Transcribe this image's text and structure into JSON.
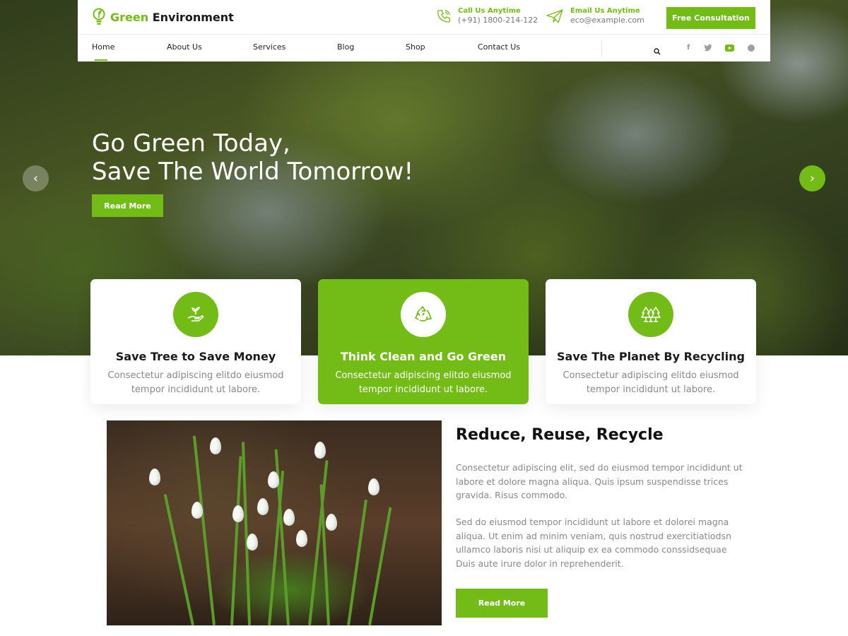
{
  "brand": {
    "name_part1": "Green",
    "name_part2": " Environment"
  },
  "header": {
    "call_label": "Call Us Anytime",
    "call_value": "(+91) 1800-214-122",
    "email_label": "Email Us Anytime",
    "email_value": "eco@example.com",
    "cta_label": "Free Consultation"
  },
  "nav": {
    "items": [
      "Home",
      "About Us",
      "Services",
      "Blog",
      "Shop",
      "Contact Us"
    ],
    "active": "Home"
  },
  "social_icons": [
    "facebook-icon",
    "twitter-icon",
    "youtube-icon",
    "instagram-icon"
  ],
  "hero": {
    "title_line1": "Go Green Today,",
    "title_line2": "Save The World Tomorrow!",
    "button_label": "Read More"
  },
  "features": [
    {
      "icon": "hand-plant-icon",
      "title": "Save Tree to Save Money",
      "text": "Consectetur adipiscing elitdo eiusmod tempor incididunt ut labore."
    },
    {
      "icon": "recycle-icon",
      "title": "Think Clean and Go Green",
      "text": "Consectetur adipiscing elitdo eiusmod tempor incididunt ut labore."
    },
    {
      "icon": "trees-icon",
      "title": "Save The Planet By Recycling",
      "text": "Consectetur adipiscing elitdo eiusmod tempor incididunt ut labore."
    }
  ],
  "about": {
    "title": "Reduce, Reuse, Recycle",
    "paragraph1": "Consectetur adipiscing elit, sed do eiusmod tempor incididunt ut labore et dolore magna aliqua. Quis ipsum suspendisse trices gravida. Risus commodo.",
    "paragraph2": "Sed do eiusmod tempor incididunt ut labore et dolorei magna aliqua. Ut enim ad minim veniam, quis nostrud exercitiatiodsn ullamco laboris nisi ut aliquip ex ea commodo conssidsequae Duis aute irure dolor in reprehenderit.",
    "button_label": "Read More"
  },
  "colors": {
    "accent": "#73bb16",
    "text_dark": "#111111",
    "text_muted": "#888888"
  }
}
